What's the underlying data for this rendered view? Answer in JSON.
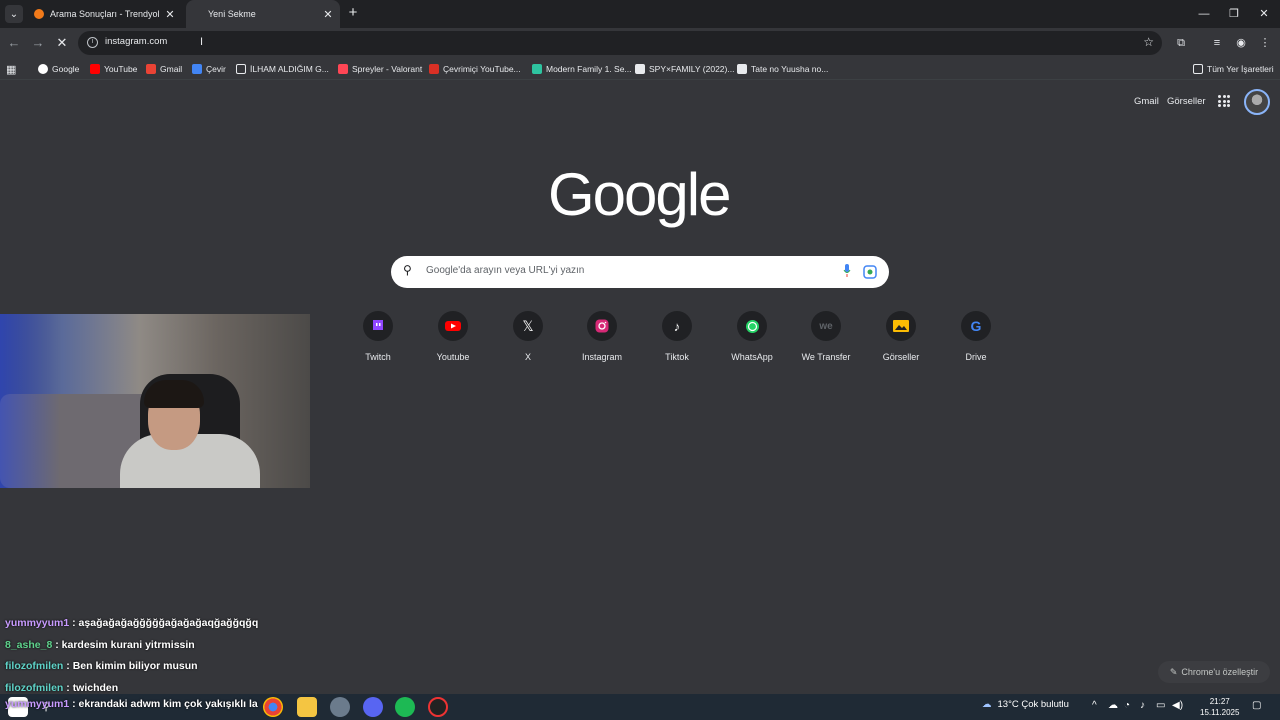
{
  "browser": {
    "tabs": [
      {
        "title": "Arama Sonuçları - Trendyol",
        "active": false
      },
      {
        "title": "Yeni Sekme",
        "active": true
      }
    ],
    "address": "instagram.com",
    "bookmarks": [
      {
        "label": "Google",
        "icon": "google-icon"
      },
      {
        "label": "YouTube",
        "icon": "youtube-icon"
      },
      {
        "label": "Gmail",
        "icon": "gmail-icon"
      },
      {
        "label": "Çevir",
        "icon": "translate-icon"
      },
      {
        "label": "İLHAM ALDIĞIM G...",
        "icon": "folder-icon"
      },
      {
        "label": "Spreyler - Valorant",
        "icon": "valorant-icon"
      },
      {
        "label": "Çevrimiçi YouTube...",
        "icon": "converter-icon"
      },
      {
        "label": "Modern Family 1. Se...",
        "icon": "site-icon"
      },
      {
        "label": "SPY×FAMILY (2022)...",
        "icon": "site-icon"
      },
      {
        "label": "Tate no Yuusha no...",
        "icon": "site-icon"
      }
    ],
    "all_bookmarks": "Tüm Yer İşaretleri"
  },
  "newtab": {
    "gmail": "Gmail",
    "images": "Görseller",
    "logo": "Google",
    "search_placeholder": "Google'da arayın veya URL'yi yazın",
    "shortcuts": [
      {
        "label": "Twitch",
        "color": "#9146ff"
      },
      {
        "label": "Youtube",
        "color": "#ff0000"
      },
      {
        "label": "X",
        "color": "#ffffff"
      },
      {
        "label": "Instagram",
        "color": "#e1306c"
      },
      {
        "label": "Tiktok",
        "color": "#ffffff"
      },
      {
        "label": "WhatsApp",
        "color": "#25d366"
      },
      {
        "label": "We Transfer",
        "color": "#5f6368"
      },
      {
        "label": "Görseller",
        "color": "#fbbc04"
      },
      {
        "label": "Drive",
        "color": "#4285f4"
      }
    ],
    "customize": "Chrome'u özelleştir"
  },
  "chat": [
    {
      "user": "yummyyum1",
      "msg": "aşağağağağğğğğağağağaqğağğqğq",
      "color": "#c89bff"
    },
    {
      "user": "8_ashe_8",
      "msg": "kardesim kurani yitrmissin",
      "color": "#5fd38d"
    },
    {
      "user": "filozofmilen",
      "msg": "Ben kimim biliyor musun",
      "color": "#5fd3c8"
    },
    {
      "user": "filozofmilen",
      "msg": "twichden",
      "color": "#5fd3c8"
    },
    {
      "user": "yummyyum1",
      "msg": "ekrandaki adwm kim çok yakışıklı la",
      "color": "#c89bff"
    }
  ],
  "taskbar": {
    "weather": "13°C  Çok bulutlu",
    "time": "21:27",
    "date": "15.11.2025"
  }
}
